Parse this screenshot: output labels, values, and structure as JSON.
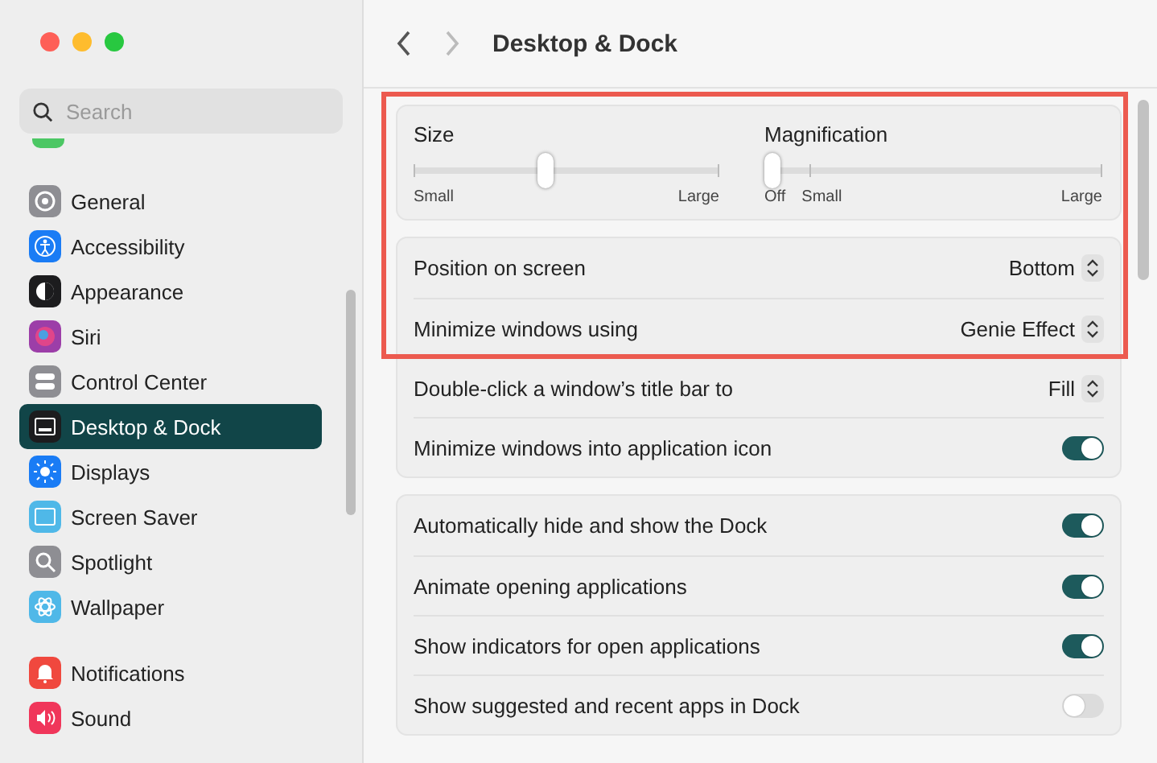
{
  "window": {
    "title": "Desktop & Dock"
  },
  "search": {
    "placeholder": "Search"
  },
  "sidebar": {
    "groups": [
      {
        "items": [
          {
            "label": "General",
            "color": "#8e8e93",
            "selected": false
          },
          {
            "label": "Accessibility",
            "color": "#1a7cf5",
            "selected": false
          },
          {
            "label": "Appearance",
            "color": "#1c1c1e",
            "selected": false
          },
          {
            "label": "Siri",
            "color": "#9c3ea8",
            "selected": false
          },
          {
            "label": "Control Center",
            "color": "#8e8e93",
            "selected": false
          },
          {
            "label": "Desktop & Dock",
            "color": "#1c1c1e",
            "selected": true
          },
          {
            "label": "Displays",
            "color": "#1a7cf5",
            "selected": false
          },
          {
            "label": "Screen Saver",
            "color": "#4fb8e8",
            "selected": false
          },
          {
            "label": "Spotlight",
            "color": "#8e8e93",
            "selected": false
          },
          {
            "label": "Wallpaper",
            "color": "#4fb8e8",
            "selected": false
          }
        ]
      },
      {
        "items": [
          {
            "label": "Notifications",
            "color": "#f0483e",
            "selected": false
          },
          {
            "label": "Sound",
            "color": "#f0365a",
            "selected": false
          }
        ]
      }
    ]
  },
  "sliders": [
    {
      "label": "Size",
      "level": 0.43,
      "ticks": [
        "Small",
        "Large"
      ]
    },
    {
      "label": "Magnification",
      "level": 0,
      "ticks": [
        "Off",
        "Small",
        "Large"
      ]
    }
  ],
  "cards": [
    {
      "rows": [
        {
          "kind": "select",
          "label": "Position on screen",
          "value": "Bottom"
        },
        {
          "kind": "select",
          "label": "Minimize windows using",
          "value": "Genie Effect"
        },
        {
          "kind": "select",
          "label": "Double-click a window’s title bar to",
          "value": "Fill"
        },
        {
          "kind": "toggle",
          "label": "Minimize windows into application icon",
          "on": true
        }
      ]
    },
    {
      "rows": [
        {
          "kind": "toggle",
          "label": "Automatically hide and show the Dock",
          "on": true
        },
        {
          "kind": "toggle",
          "label": "Animate opening applications",
          "on": true
        },
        {
          "kind": "toggle",
          "label": "Show indicators for open applications",
          "on": true
        },
        {
          "kind": "toggle",
          "label": "Show suggested and recent apps in Dock",
          "on": false
        }
      ]
    }
  ]
}
